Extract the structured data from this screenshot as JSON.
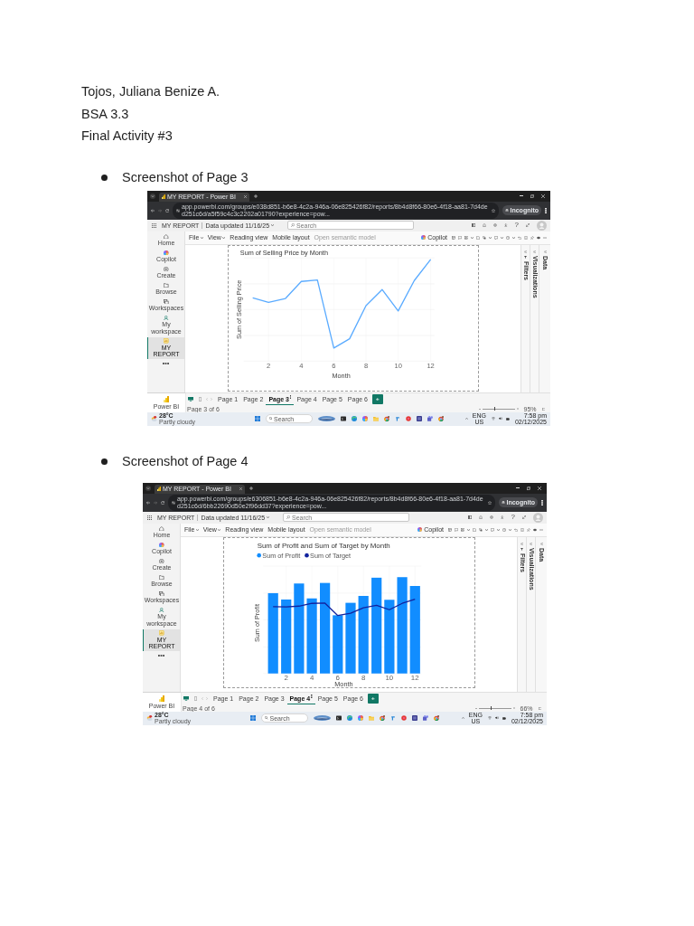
{
  "student": {
    "name": "Tojos, Juliana Benize A.",
    "section": "BSA 3.3",
    "activity": "Final Activity #3"
  },
  "entries": [
    {
      "caption": "Screenshot of Page 3",
      "screenshot": {
        "browser": {
          "tab_title": "MY REPORT - Power BI",
          "url": "app.powerbi.com/groups/e038d851-b6e8-4c2a-946a-06e825426f82/reports/8b4d8f66-80e6-4f18-aa81-7d4ded251c6d/a5f59c4c3c2202a01790?experience=pow...",
          "profile": "Incognito"
        },
        "app_bar": {
          "report": "MY REPORT",
          "updated": "Data updated 11/16/25",
          "search": {
            "placeholder": "Search"
          },
          "help": "?"
        },
        "ribbon": {
          "menus": [
            {
              "label": "File",
              "dropdown": true,
              "disabled": false
            },
            {
              "label": "View",
              "dropdown": true,
              "disabled": false
            },
            {
              "label": "Reading view",
              "dropdown": false,
              "disabled": false
            },
            {
              "label": "Mobile layout",
              "dropdown": false,
              "disabled": false
            },
            {
              "label": "Open semantic model",
              "dropdown": false,
              "disabled": true
            }
          ],
          "copilot": "Copilot"
        },
        "nav": [
          {
            "label": "Home",
            "selected": false
          },
          {
            "label": "Copilot",
            "selected": false
          },
          {
            "label": "Create",
            "selected": false
          },
          {
            "label": "Browse",
            "selected": false
          },
          {
            "label": "Workspaces",
            "selected": false
          },
          {
            "label": "My workspace",
            "selected": false
          },
          {
            "label": "MY REPORT",
            "selected": true
          }
        ],
        "visual": {
          "kind": "line",
          "title": "Sum of Selling Price by Month",
          "y_axis": "Sum of Selling Price",
          "x_axis": "Month",
          "x_ticks": [
            "2",
            "4",
            "6",
            "8",
            "10",
            "12"
          ]
        },
        "panes": [
          "Filters",
          "Visualizations",
          "Data"
        ],
        "app_switcher": "Power BI",
        "pages": [
          {
            "label": "Page 1",
            "selected": false
          },
          {
            "label": "Page 2",
            "selected": false
          },
          {
            "label": "Page 3",
            "selected": true
          },
          {
            "label": "Page 4",
            "selected": false
          },
          {
            "label": "Page 5",
            "selected": false
          },
          {
            "label": "Page 6",
            "selected": false
          }
        ],
        "page_status": "Page 3 of 6",
        "zoom": {
          "level": 0.37,
          "reading": "95%"
        },
        "taskbar": {
          "temperature": "28°C",
          "weather": "Partly cloudy",
          "search": {
            "placeholder": "Search"
          },
          "language": "ENG",
          "region": "US",
          "time": "7:58 pm",
          "date": "02/12/2025"
        }
      }
    },
    {
      "caption": "Screenshot of Page 4",
      "screenshot": {
        "browser": {
          "tab_title": "MY REPORT - Power BI",
          "url": "app.powerbi.com/groups/e6306851-b6e8-4c2a-946a-06e825426f82/reports/8b4d8f66-80e6-4f18-aa81-7d4ded251c6d/6bb22690d50e2f96dd37?experience=pow...",
          "profile": "Incognito"
        },
        "app_bar": {
          "report": "MY REPORT",
          "updated": "Data updated 11/16/25",
          "search": {
            "placeholder": "Search"
          },
          "help": "?"
        },
        "ribbon": {
          "menus": [
            {
              "label": "File",
              "dropdown": true,
              "disabled": false
            },
            {
              "label": "View",
              "dropdown": true,
              "disabled": false
            },
            {
              "label": "Reading view",
              "dropdown": false,
              "disabled": false
            },
            {
              "label": "Mobile layout",
              "dropdown": false,
              "disabled": false
            },
            {
              "label": "Open semantic model",
              "dropdown": false,
              "disabled": true
            }
          ],
          "copilot": "Copilot"
        },
        "nav": [
          {
            "label": "Home",
            "selected": false
          },
          {
            "label": "Copilot",
            "selected": false
          },
          {
            "label": "Create",
            "selected": false
          },
          {
            "label": "Browse",
            "selected": false
          },
          {
            "label": "Workspaces",
            "selected": false
          },
          {
            "label": "My workspace",
            "selected": false
          },
          {
            "label": "MY REPORT",
            "selected": true
          }
        ],
        "visual": {
          "kind": "bar_line",
          "title": "Sum of Profit and Sum of Target by Month",
          "legend": [
            {
              "label": "Sum of Profit",
              "color": "#118dff"
            },
            {
              "label": "Sum of Target",
              "color": "#12239e"
            }
          ],
          "y_axis": "Sum of Profit",
          "x_axis": "Month",
          "x_ticks": [
            "2",
            "4",
            "6",
            "8",
            "10",
            "12"
          ]
        },
        "panes": [
          "Filters",
          "Visualizations",
          "Data"
        ],
        "app_switcher": "Power BI",
        "pages": [
          {
            "label": "Page 1",
            "selected": false
          },
          {
            "label": "Page 2",
            "selected": false
          },
          {
            "label": "Page 3",
            "selected": false
          },
          {
            "label": "Page 4",
            "selected": true
          },
          {
            "label": "Page 5",
            "selected": false
          },
          {
            "label": "Page 6",
            "selected": false
          }
        ],
        "page_status": "Page 4 of 6",
        "zoom": {
          "level": 0.36,
          "reading": "66%"
        },
        "taskbar": {
          "temperature": "28°C",
          "weather": "Partly cloudy",
          "search": {
            "placeholder": "Search"
          },
          "language": "ENG",
          "region": "US",
          "time": "7:58 pm",
          "date": "02/12/2025"
        }
      }
    }
  ]
}
